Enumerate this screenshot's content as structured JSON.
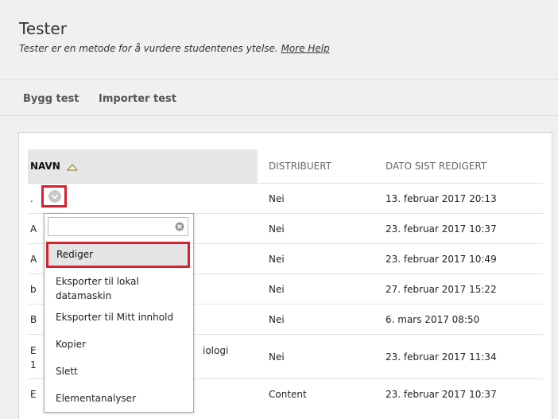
{
  "page": {
    "title": "Tester",
    "subtitle": "Tester er en metode for å vurdere studentenes ytelse.",
    "help_link": "More Help"
  },
  "actions": {
    "build": "Bygg test",
    "import": "Importer test"
  },
  "table": {
    "columns": [
      "NAVN",
      "DISTRIBUERT",
      "DATO SIST REDIGERT"
    ],
    "rows": [
      {
        "name": ".",
        "distributed": "Nei",
        "date": "13. februar 2017 20:13"
      },
      {
        "name": "A",
        "distributed": "Nei",
        "date": "23. februar 2017 10:37"
      },
      {
        "name": "A",
        "distributed": "Nei",
        "date": "23. februar 2017 10:49"
      },
      {
        "name": "b",
        "distributed": "Nei",
        "date": "27. februar 2017 15:22"
      },
      {
        "name": "B",
        "distributed": "Nei",
        "date": "6. mars 2017 08:50"
      },
      {
        "name_line1": "E",
        "name_line1_tail": "iologi",
        "name_line2": "1",
        "distributed": "Nei",
        "date": "23. februar 2017 11:34"
      },
      {
        "name": "E",
        "distributed": "Content",
        "date": "23. februar 2017 10:37"
      }
    ]
  },
  "menu": {
    "search_value": "",
    "items": [
      "Rediger",
      "Eksporter til lokal datamaskin",
      "Eksporter til Mitt innhold",
      "Kopier",
      "Slett",
      "Elementanalyser"
    ]
  },
  "colors": {
    "highlight": "#d4222e",
    "background": "#f0f0f0",
    "header_sorted": "#e6e6e6"
  },
  "icons": [
    "sort-ascending-icon",
    "chevron-down-icon",
    "clear-icon"
  ]
}
